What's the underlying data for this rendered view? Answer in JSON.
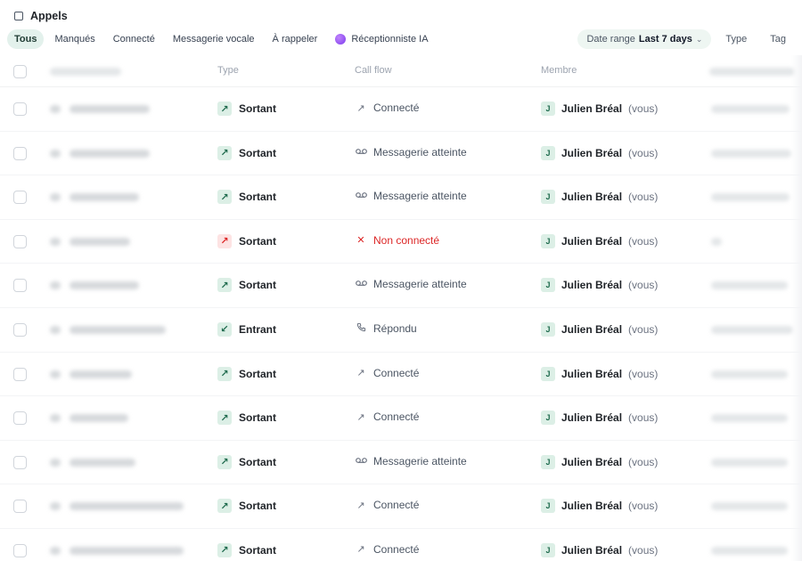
{
  "header": {
    "title": "Appels"
  },
  "tabs": [
    {
      "label": "Tous",
      "active": true
    },
    {
      "label": "Manqués",
      "active": false
    },
    {
      "label": "Connecté",
      "active": false
    },
    {
      "label": "Messagerie vocale",
      "active": false
    },
    {
      "label": "À rappeler",
      "active": false
    },
    {
      "label": "Réceptionniste IA",
      "active": false,
      "icon": "ai-orb-icon"
    }
  ],
  "filters": {
    "date_label": "Date range",
    "date_value": "Last 7 days",
    "type_label": "Type",
    "tag_label": "Tag"
  },
  "columns": {
    "contact": "",
    "type": "Type",
    "flow": "Call flow",
    "member": "Membre"
  },
  "member": {
    "name": "Julien Bréal",
    "suffix": "(vous)",
    "initial": "J"
  },
  "rows": [
    {
      "type": "Sortant",
      "type_icon": "↗",
      "type_color": "green",
      "flow": "Connecté",
      "flow_icon": "↗",
      "flow_color": "gray"
    },
    {
      "type": "Sortant",
      "type_icon": "↗",
      "type_color": "green",
      "flow": "Messagerie atteinte",
      "flow_icon": "voicemail",
      "flow_color": "gray"
    },
    {
      "type": "Sortant",
      "type_icon": "↗",
      "type_color": "green",
      "flow": "Messagerie atteinte",
      "flow_icon": "voicemail",
      "flow_color": "gray"
    },
    {
      "type": "Sortant",
      "type_icon": "↗",
      "type_color": "red",
      "flow": "Non connecté",
      "flow_icon": "✕",
      "flow_color": "red"
    },
    {
      "type": "Sortant",
      "type_icon": "↗",
      "type_color": "green",
      "flow": "Messagerie atteinte",
      "flow_icon": "voicemail",
      "flow_color": "gray"
    },
    {
      "type": "Entrant",
      "type_icon": "↙",
      "type_color": "green",
      "flow": "Répondu",
      "flow_icon": "phone",
      "flow_color": "gray"
    },
    {
      "type": "Sortant",
      "type_icon": "↗",
      "type_color": "green",
      "flow": "Connecté",
      "flow_icon": "↗",
      "flow_color": "gray"
    },
    {
      "type": "Sortant",
      "type_icon": "↗",
      "type_color": "green",
      "flow": "Connecté",
      "flow_icon": "↗",
      "flow_color": "gray"
    },
    {
      "type": "Sortant",
      "type_icon": "↗",
      "type_color": "green",
      "flow": "Messagerie atteinte",
      "flow_icon": "voicemail",
      "flow_color": "gray"
    },
    {
      "type": "Sortant",
      "type_icon": "↗",
      "type_color": "green",
      "flow": "Connecté",
      "flow_icon": "↗",
      "flow_color": "gray"
    },
    {
      "type": "Sortant",
      "type_icon": "↗",
      "type_color": "green",
      "flow": "Connecté",
      "flow_icon": "↗",
      "flow_color": "gray"
    }
  ],
  "colors": {
    "accent_bg": "#e3f1ec",
    "accent_fg": "#1f6b4e",
    "error": "#dc2626"
  }
}
